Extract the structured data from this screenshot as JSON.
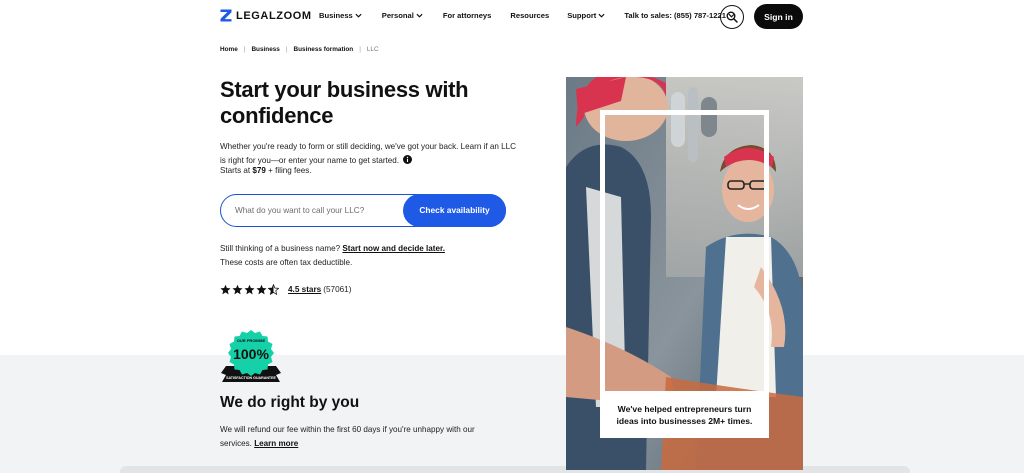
{
  "brand": {
    "name": "LEGALZOOM",
    "accent": "#1f5ae6"
  },
  "nav": {
    "items": [
      {
        "label": "Business",
        "dropdown": true
      },
      {
        "label": "Personal",
        "dropdown": true
      },
      {
        "label": "For attorneys",
        "dropdown": false
      },
      {
        "label": "Resources",
        "dropdown": false
      },
      {
        "label": "Support",
        "dropdown": true
      },
      {
        "label": "Talk to sales: (855) 787-1221",
        "dropdown": true
      }
    ],
    "search_icon": "search-icon",
    "signin_label": "Sign in"
  },
  "breadcrumb": {
    "items": [
      "Home",
      "Business",
      "Business formation"
    ],
    "current": "LLC"
  },
  "hero": {
    "title": "Start your business with confidence",
    "subtitle": "Whether you're ready to form or still deciding, we've got your back. Learn if an LLC is right for you—or enter your name to get started.",
    "price_prefix": "Starts at ",
    "price": "$79",
    "price_suffix": " + filing fees.",
    "input_placeholder": "What do you want to call your LLC?",
    "input_value": "",
    "cta_label": "Check availability",
    "still_thinking": "Still thinking of a business name?",
    "still_link": "Start now and decide later.",
    "tax_note": "These costs are often tax deductible."
  },
  "rating": {
    "stars": 4.5,
    "label": "4.5 stars",
    "count": "(57061)"
  },
  "guarantee": {
    "badge_top": "OUR PROMISE",
    "badge_number": "100%",
    "badge_ribbon": "SATISFACTION GUARANTEE",
    "title": "We do right by you",
    "desc": "We will refund our fee within the first 60 days if you're unhappy with our services.",
    "learn_more": "Learn more"
  },
  "photo": {
    "caption": "We've helped entrepreneurs turn ideas into businesses 2M+ times."
  }
}
